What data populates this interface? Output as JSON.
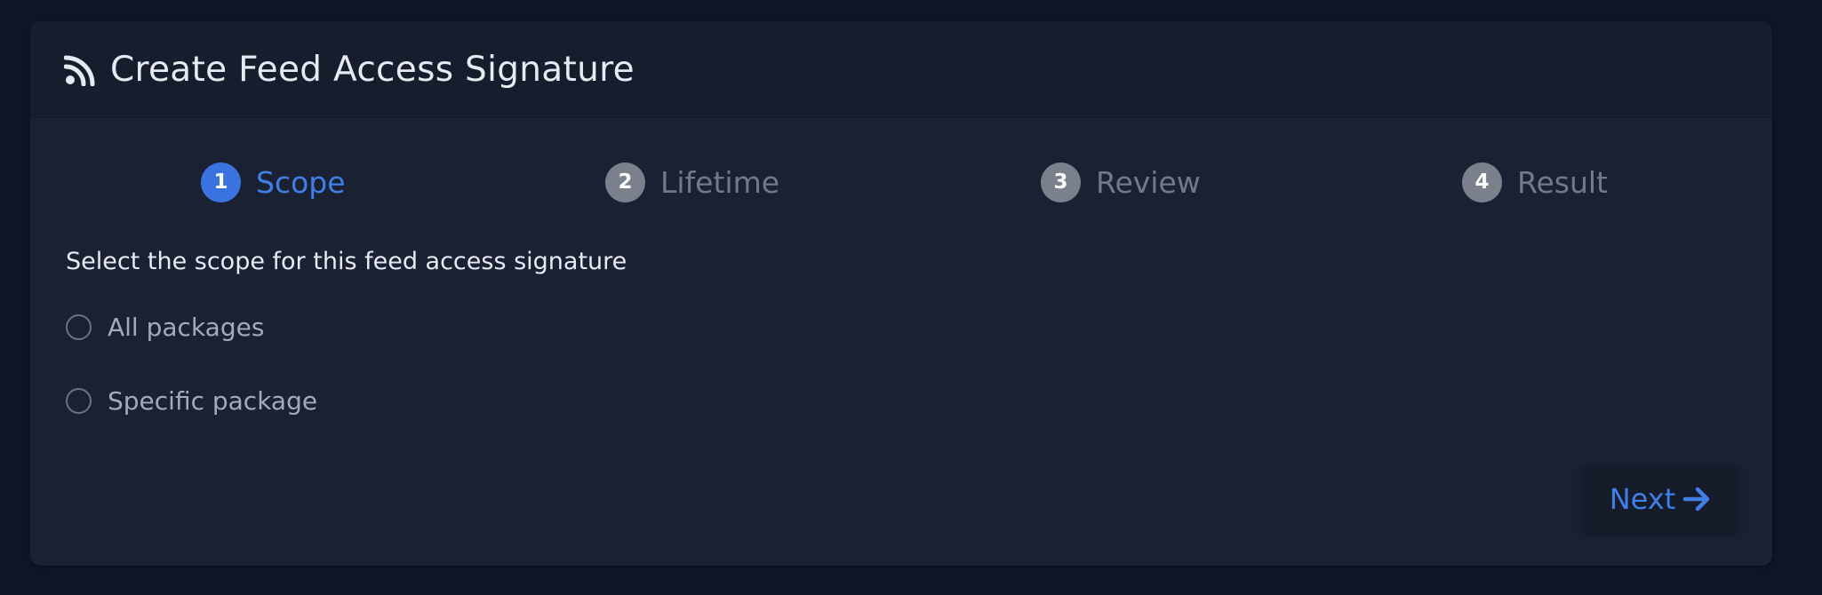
{
  "header": {
    "icon": "rss-icon",
    "title": "Create Feed Access Signature"
  },
  "steps": [
    {
      "number": "1",
      "label": "Scope",
      "active": true
    },
    {
      "number": "2",
      "label": "Lifetime",
      "active": false
    },
    {
      "number": "3",
      "label": "Review",
      "active": false
    },
    {
      "number": "4",
      "label": "Result",
      "active": false
    }
  ],
  "form": {
    "prompt": "Select the scope for this feed access signature",
    "options": [
      {
        "label": "All packages",
        "selected": false
      },
      {
        "label": "Specific package",
        "selected": false
      }
    ]
  },
  "footer": {
    "next_label": "Next",
    "next_icon": "arrow-right-icon"
  },
  "colors": {
    "background": "#0f1626",
    "card": "#1a2132",
    "header": "#161d2c",
    "accent": "#3f7fe6",
    "inactive_step": "#7a818c"
  }
}
